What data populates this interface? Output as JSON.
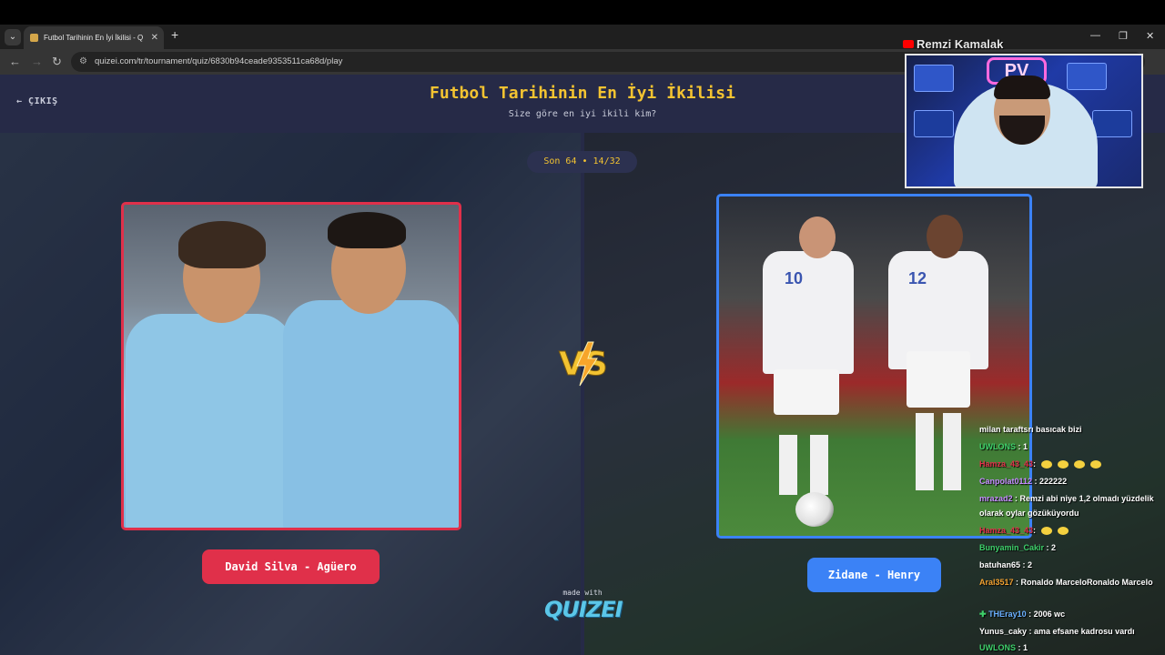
{
  "browser": {
    "tab_title": "Futbol Tarihinin En İyi İkilisi - Q",
    "tab_close": "✕",
    "new_tab": "+",
    "url": "quizei.com/tr/tournament/quiz/6830b94ceade9353511ca68d/play",
    "window_controls": [
      "—",
      "❐",
      "✕"
    ]
  },
  "header": {
    "exit_label": "ÇIKIŞ",
    "title": "Futbol Tarihinin En İyi İkilisi",
    "subtitle": "Size göre en iyi ikili kim?"
  },
  "round": {
    "label": "Son 64 • 14/32"
  },
  "matchup": {
    "left": {
      "name": "David Silva - Agüero",
      "border_color": "#e0304a"
    },
    "right": {
      "name": "Zidane - Henry",
      "border_color": "#3b82f6"
    },
    "vs_label": "VS"
  },
  "footer": {
    "made_with": "made with",
    "brand": "QUIZEI"
  },
  "stream": {
    "streamer_name": "Remzi Kamalak",
    "chat": [
      {
        "user": "",
        "text": "milan taraftsrı basıcak bizi",
        "user_color": "#ffffff"
      },
      {
        "user": "UWLONS",
        "text": ": 1",
        "user_color": "#3ecf6a"
      },
      {
        "user": "Hamza_43_43",
        "text": ":",
        "user_color": "#e0304a",
        "emotes": 4
      },
      {
        "user": "Canpolat0112",
        "text": ": 222222",
        "user_color": "#c58cff"
      },
      {
        "user": "mrazad2",
        "text": ": Remzi abi niye 1,2 olmadı yüzdelik olarak oylar gözüküyordu",
        "user_color": "#c58cff"
      },
      {
        "user": "Hamza_43_43",
        "text": ":",
        "user_color": "#e0304a",
        "emotes": 2
      },
      {
        "user": "Bunyamin_Cakir",
        "text": ": 2",
        "user_color": "#3ecf6a"
      },
      {
        "user": "batuhan65",
        "text": ": 2",
        "user_color": "#ffffff"
      },
      {
        "user": "Aral3517",
        "text": ": Ronaldo MarceloRonaldo Marcelo",
        "user_color": "#f0a030"
      },
      {
        "user": "THEray10",
        "text": ": 2006 wc",
        "user_color": "#6ab0ff"
      },
      {
        "user": "Yunus_caky",
        "text": ": ama efsane kadrosu vardı",
        "user_color": "#ffffff"
      },
      {
        "user": "UWLONS",
        "text": ": 1",
        "user_color": "#3ecf6a"
      }
    ]
  }
}
